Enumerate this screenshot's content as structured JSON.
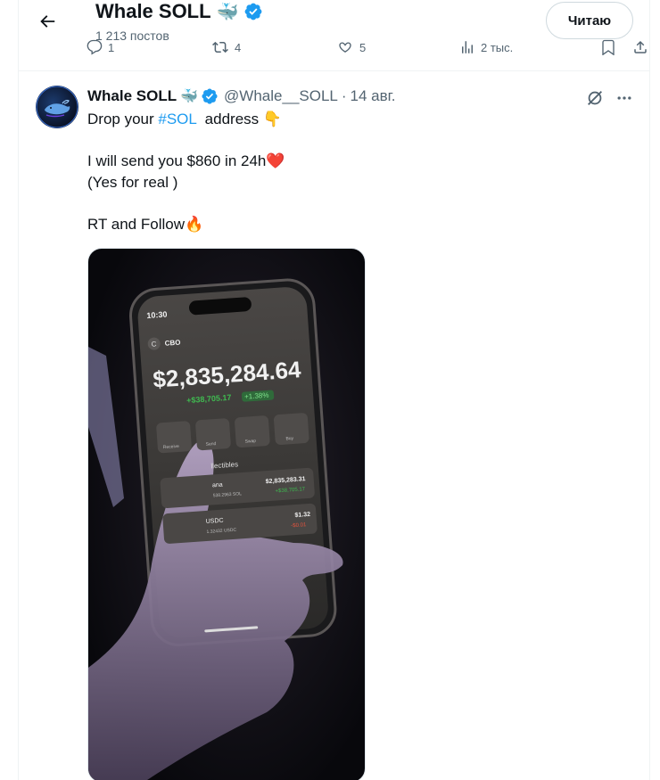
{
  "header": {
    "name": "Whale SOLL",
    "name_emoji": "🐳",
    "posts_count": "1 213 постов",
    "follow_label": "Читаю",
    "prev_counts": {
      "replies": "1",
      "reposts": "4",
      "likes": "5",
      "views": "2 тыс."
    }
  },
  "tweet": {
    "author_name": "Whale SOLL",
    "author_emoji": "🐳",
    "handle": "@Whale__SOLL",
    "separator": "·",
    "time": "14 авг.",
    "text": {
      "line1_before": "Drop your ",
      "hashtag": "#SOL",
      "line1_after": "  address ",
      "line1_emoji": "👇",
      "line2": "I will send you $860 in 24h",
      "line2_emoji": "❤️",
      "line3": "(Yes for real )",
      "line4": "RT and Follow",
      "line4_emoji": "🔥"
    },
    "media": {
      "phone_time": "10:30",
      "account_initial": "C",
      "account_name": "CBO",
      "balance": "$2,835,284.64",
      "change_amount": "+$38,705.17",
      "change_percent": "+1.38%",
      "actions": [
        "Receive",
        "Send",
        "Swap",
        "Buy"
      ],
      "tabs_label": "llectibles",
      "rows": [
        {
          "name": "ana",
          "sub": "538.2963 SOL",
          "value": "$2,835,283.31",
          "delta": "+$38,705.17"
        },
        {
          "name": "USDC",
          "sub": "1.32432 USDC",
          "value": "$1.32",
          "delta": "-$0.01"
        }
      ]
    }
  },
  "colors": {
    "accent": "#1d9bf0",
    "verified": "#1d9bf0",
    "muted": "#536471",
    "positive": "#3fb950",
    "negative": "#e5533d"
  }
}
